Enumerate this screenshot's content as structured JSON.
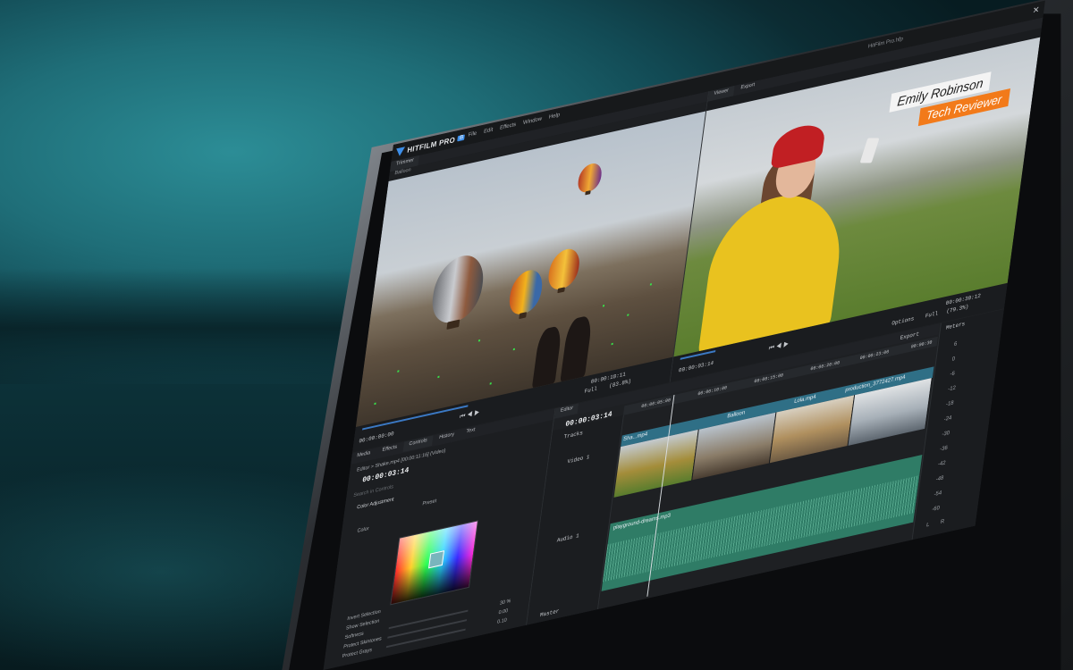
{
  "app": {
    "logo_text": "HITFILM PRO",
    "logo_badge": "B",
    "window_title": "HitFilm Pro.hfp",
    "menu": [
      "File",
      "Edit",
      "Effects",
      "Window",
      "Help"
    ],
    "close_glyph": "✕"
  },
  "trimmer": {
    "tab": "Trimmer",
    "clip_name": "Balloon",
    "timecode_in": "00:00:00:00",
    "timecode_duration": "00:00:18:11",
    "quality": "Full",
    "zoom": "(83.8%)"
  },
  "viewer": {
    "tabs": [
      "Viewer",
      "Export"
    ],
    "lower_third": {
      "name": "Emily Robinson",
      "role": "Tech Reviewer"
    },
    "timecode": "00:00:03:14",
    "timecode_end": "00:00:30:12",
    "options_label": "Options",
    "quality": "Full",
    "zoom": "(79.3%)"
  },
  "controls_panel": {
    "tabs": [
      "Media",
      "Effects",
      "Controls",
      "History",
      "Text"
    ],
    "layer_path": "Editor > Shake.mp4 [00:00:11:16] (Video)",
    "timecode": "00:00:03:14",
    "search_placeholder": "Search in Controls",
    "effect_name": "Color Adjustment",
    "preset_label": "Preset",
    "color_label": "Color",
    "rows": [
      {
        "label": "Invert Selection",
        "value": ""
      },
      {
        "label": "Show Selection",
        "value": ""
      },
      {
        "label": "Softness",
        "value": "30 %"
      },
      {
        "label": "Protect Skintones",
        "value": "0.00"
      },
      {
        "label": "Protect Grays",
        "value": "0.10"
      }
    ]
  },
  "editor": {
    "tab": "Editor",
    "timecode": "00:00:03:14",
    "tracks_label": "Tracks",
    "export_label": "Export",
    "ruler_marks": [
      "00:00:05:00",
      "00:00:10:00",
      "00:00:15:00",
      "00:00:20:00",
      "00:00:23:00",
      "00:00:30"
    ],
    "video_track_label": "Video 1",
    "audio_track_label": "Audio 1",
    "master_label": "Master",
    "video_clips": [
      "Sha...mp4",
      "Balloon",
      "Lola.mp4",
      "production_3772427.mp4"
    ],
    "audio_clip": "playground-dreams.mp3"
  },
  "meters": {
    "title": "Meters",
    "scale": [
      "6",
      "0",
      "-6",
      "-12",
      "-18",
      "-24",
      "-30",
      "-36",
      "-42",
      "-48",
      "-54",
      "-60"
    ],
    "channels": [
      "L",
      "R"
    ]
  }
}
